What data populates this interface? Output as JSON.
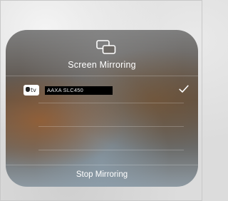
{
  "panel": {
    "title": "Screen Mirroring",
    "icon": "screen-mirroring-icon",
    "devices": [
      {
        "name": "AAXA SLC450",
        "type_label": "tv",
        "selected": true,
        "icon": "apple-tv-icon"
      }
    ],
    "stop_label": "Stop Mirroring"
  },
  "colors": {
    "text": "#ffffff",
    "device_name_bg": "#000000"
  }
}
